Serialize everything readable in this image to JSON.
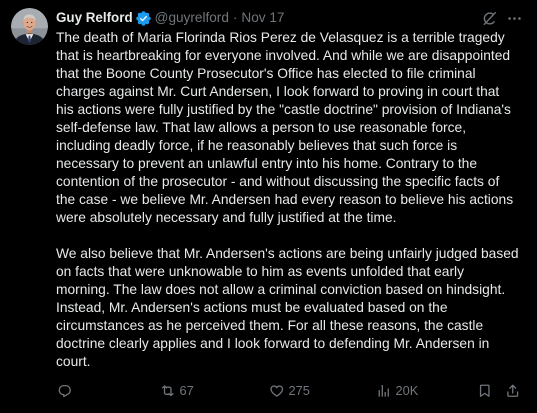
{
  "colors": {
    "background": "#000000",
    "text": "#e7e9ea",
    "muted": "#71767b",
    "verified": "#1d9bf0"
  },
  "author": {
    "name": "Guy Relford",
    "verified_icon": "verified-badge-icon",
    "handle": "@guyrelford",
    "separator": "·",
    "date": "Nov 17"
  },
  "header_icons": {
    "grok": "grok-icon",
    "more": "more-icon"
  },
  "tweet": {
    "paragraphs": [
      {
        "lines": [
          "The death of Maria Florinda Rios Perez de Velasquez is a terrible tragedy",
          "that is heartbreaking for everyone involved. And while we are disappointed",
          "that the Boone County Prosecutor's Office has elected to file criminal",
          "charges against Mr. Curt Andersen, I look forward to proving in court that",
          "his actions were fully justified by the \"castle doctrine\" provision of Indiana's",
          "self-defense law. That law allows a person to use reasonable force,",
          "including deadly force, if he reasonably believes that such force is",
          "necessary to prevent an unlawful entry into his home. Contrary to the",
          "contention of the prosecutor - and without discussing the specific facts of",
          "the case - we believe Mr. Andersen had every reason to believe his actions",
          "were absolutely necessary and fully justified at the time."
        ]
      },
      {
        "lines": [
          "We also believe that Mr. Andersen's actions are being unfairly judged based",
          "on facts that were unknowable to him as events unfolded that early",
          "morning. The law does not allow a criminal conviction based on hindsight.",
          "Instead, Mr. Andersen's actions must be evaluated based on the",
          "circumstances as he perceived them. For all these reasons, the castle",
          "doctrine clearly applies and I look forward to defending Mr. Andersen in",
          "court."
        ]
      }
    ]
  },
  "actions": {
    "reply": {
      "icon": "reply-icon"
    },
    "repost": {
      "icon": "repost-icon",
      "count": "67"
    },
    "like": {
      "icon": "heart-icon",
      "count": "275"
    },
    "views": {
      "icon": "views-icon",
      "count": "20K"
    },
    "bookmark": {
      "icon": "bookmark-icon"
    },
    "share": {
      "icon": "share-icon"
    }
  }
}
